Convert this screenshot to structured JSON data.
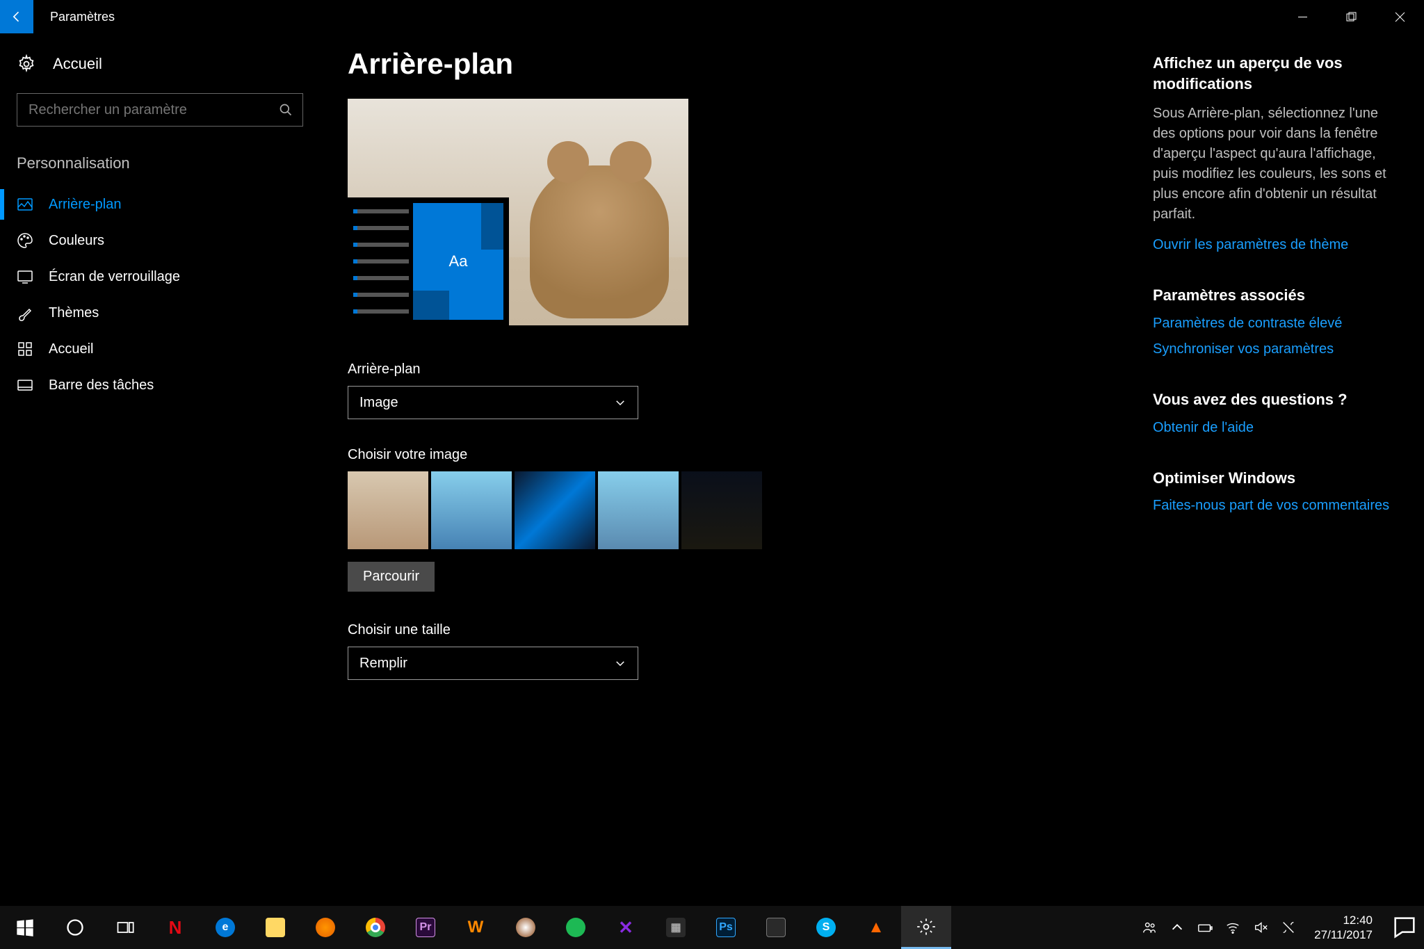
{
  "window": {
    "title": "Paramètres"
  },
  "sidebar": {
    "home": "Accueil",
    "search_placeholder": "Rechercher un paramètre",
    "section": "Personnalisation",
    "items": [
      {
        "label": "Arrière-plan"
      },
      {
        "label": "Couleurs"
      },
      {
        "label": "Écran de verrouillage"
      },
      {
        "label": "Thèmes"
      },
      {
        "label": "Accueil"
      },
      {
        "label": "Barre des tâches"
      }
    ]
  },
  "main": {
    "title": "Arrière-plan",
    "preview_sample": "Aa",
    "bg_label": "Arrière-plan",
    "bg_value": "Image",
    "choose_image": "Choisir votre image",
    "browse": "Parcourir",
    "choose_fit": "Choisir une taille",
    "fit_value": "Remplir"
  },
  "aside": {
    "preview_heading": "Affichez un aperçu de vos modifications",
    "preview_body": "Sous Arrière-plan, sélectionnez l'une des options pour voir dans la fenêtre d'aperçu l'aspect qu'aura l'affichage, puis modifiez les couleurs, les sons et plus encore afin d'obtenir un résultat parfait.",
    "theme_link": "Ouvrir les paramètres de thème",
    "related_heading": "Paramètres associés",
    "related_1": "Paramètres de contraste élevé",
    "related_2": "Synchroniser vos paramètres",
    "questions_heading": "Vous avez des questions ?",
    "help_link": "Obtenir de l'aide",
    "optimize_heading": "Optimiser Windows",
    "feedback_link": "Faites-nous part de vos commentaires"
  },
  "clock": {
    "time": "12:40",
    "date": "27/11/2017"
  }
}
